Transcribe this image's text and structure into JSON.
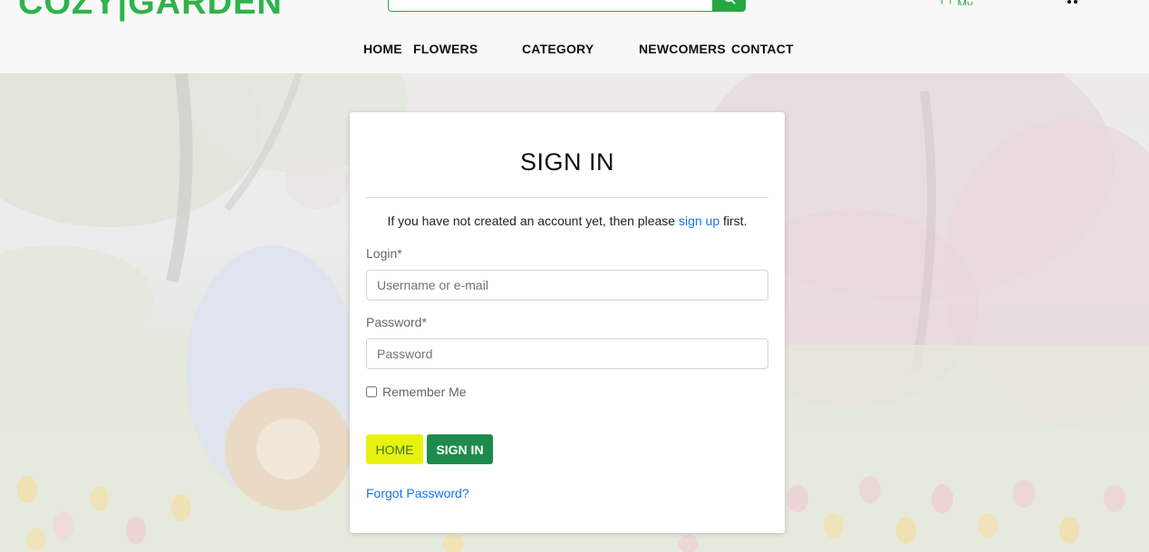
{
  "brand": {
    "logo": "COZY|GARDEN"
  },
  "search": {
    "placeholder": ""
  },
  "account": {
    "label": "My Account"
  },
  "nav": {
    "items": [
      "HOME",
      "FLOWERS",
      "CATEGORY",
      "NEWCOMERS",
      "CONTACT"
    ]
  },
  "signin": {
    "title": "SIGN IN",
    "intro_before": "If you have not created an account yet, then please ",
    "intro_link": "sign up",
    "intro_after": " first.",
    "login_label": "Login*",
    "login_placeholder": "Username or e-mail",
    "password_label": "Password*",
    "password_placeholder": "Password",
    "remember_label": "Remember Me",
    "home_button": "HOME",
    "signin_button": "SIGN IN",
    "forgot_link": "Forgot Password?"
  },
  "colors": {
    "brand_green": "#2fb34a",
    "signin_button": "#1e8a4c",
    "home_button": "#e8f20f",
    "link_blue": "#1a73e8"
  },
  "icons": {
    "search": "magnifier-icon",
    "account": "user-icon",
    "cart": "cart-icon"
  }
}
